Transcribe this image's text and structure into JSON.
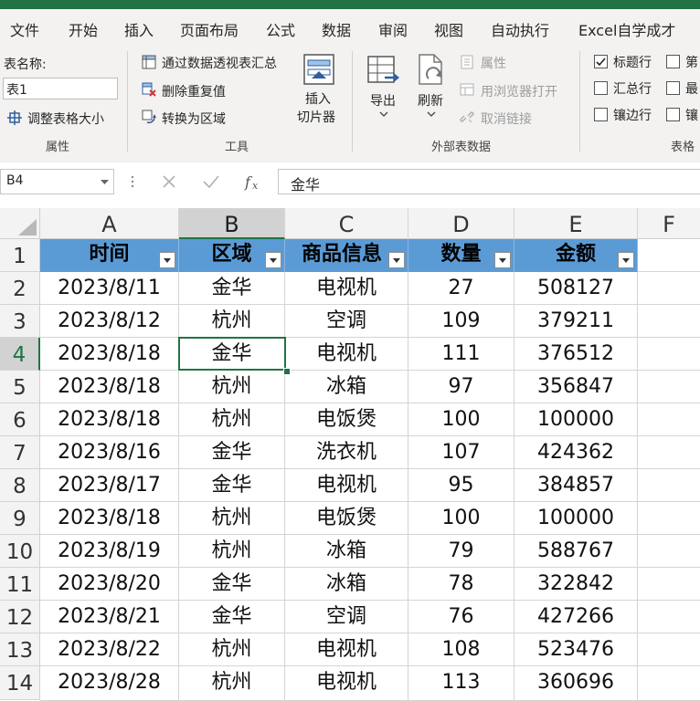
{
  "tabs": [
    "文件",
    "开始",
    "插入",
    "页面布局",
    "公式",
    "数据",
    "审阅",
    "视图",
    "自动执行",
    "Excel自学成才"
  ],
  "ribbon": {
    "properties": {
      "table_name_label": "表名称:",
      "table_name_value": "表1",
      "resize_label": "调整表格大小",
      "group_label": "属性"
    },
    "tools": {
      "pivot_label": "通过数据透视表汇总",
      "remove_dup_label": "删除重复值",
      "convert_label": "转换为区域",
      "slicer_label_1": "插入",
      "slicer_label_2": "切片器",
      "group_label": "工具"
    },
    "external": {
      "export_label": "导出",
      "refresh_label": "刷新",
      "properties_label": "属性",
      "open_browser_label": "用浏览器打开",
      "unlink_label": "取消链接",
      "group_label": "外部表数据"
    },
    "style_options": {
      "header_row_label": "标题行",
      "total_row_label": "汇总行",
      "banded_rows_label": "镶边行",
      "first_col_label": "第",
      "last_col_label": "最",
      "banded_cols_label": "镶",
      "group_label": "表格"
    }
  },
  "formula_bar": {
    "name_box": "B4",
    "formula": "金华"
  },
  "grid": {
    "columns": [
      "A",
      "B",
      "C",
      "D",
      "E",
      "F"
    ],
    "header_row": [
      "时间",
      "区域",
      "商品信息",
      "数量",
      "金额"
    ],
    "row_numbers": [
      "1",
      "2",
      "3",
      "4",
      "5",
      "6",
      "7",
      "8",
      "9",
      "10",
      "11",
      "12",
      "13",
      "14"
    ],
    "rows": [
      [
        "2023/8/11",
        "金华",
        "电视机",
        "27",
        "508127"
      ],
      [
        "2023/8/12",
        "杭州",
        "空调",
        "109",
        "379211"
      ],
      [
        "2023/8/18",
        "金华",
        "电视机",
        "111",
        "376512"
      ],
      [
        "2023/8/18",
        "杭州",
        "冰箱",
        "97",
        "356847"
      ],
      [
        "2023/8/18",
        "杭州",
        "电饭煲",
        "100",
        "100000"
      ],
      [
        "2023/8/16",
        "金华",
        "洗衣机",
        "107",
        "424362"
      ],
      [
        "2023/8/17",
        "金华",
        "电视机",
        "95",
        "384857"
      ],
      [
        "2023/8/18",
        "杭州",
        "电饭煲",
        "100",
        "100000"
      ],
      [
        "2023/8/19",
        "杭州",
        "冰箱",
        "79",
        "588767"
      ],
      [
        "2023/8/20",
        "金华",
        "冰箱",
        "78",
        "322842"
      ],
      [
        "2023/8/21",
        "金华",
        "空调",
        "76",
        "427266"
      ],
      [
        "2023/8/22",
        "杭州",
        "电视机",
        "108",
        "523476"
      ],
      [
        "2023/8/28",
        "杭州",
        "电视机",
        "113",
        "360696"
      ]
    ]
  },
  "colors": {
    "accent": "#217346",
    "table_header": "#5b9bd5"
  }
}
